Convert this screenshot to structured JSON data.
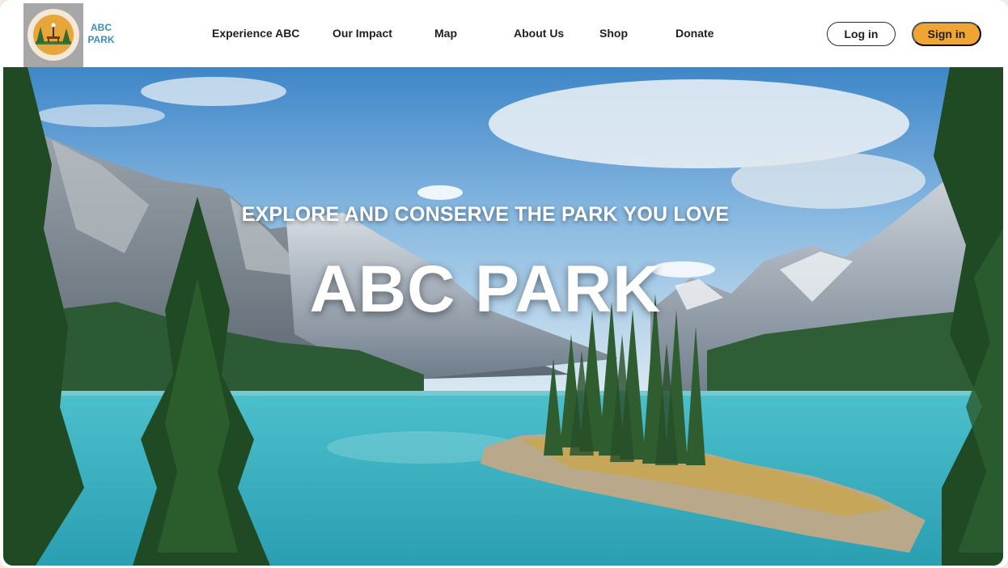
{
  "brand": {
    "line1": "ABC",
    "line2": "PARK",
    "logo_icon": "park-bench-trees-icon"
  },
  "nav": [
    {
      "label": "Experience ABC"
    },
    {
      "label": "Our Impact"
    },
    {
      "label": "Map"
    },
    {
      "label": "About Us"
    },
    {
      "label": "Shop"
    },
    {
      "label": "Donate"
    }
  ],
  "auth": {
    "login_label": "Log in",
    "signin_label": "Sign in"
  },
  "hero": {
    "tagline": "EXPLORE AND CONSERVE THE PARK YOU LOVE",
    "title": "ABC PARK",
    "image": "mountain-lake-landscape"
  },
  "colors": {
    "accent": "#f0a431",
    "brand_text": "#3b8fc0",
    "logo_bg": "#a7a7a7",
    "lake": "#3fb3c4"
  }
}
